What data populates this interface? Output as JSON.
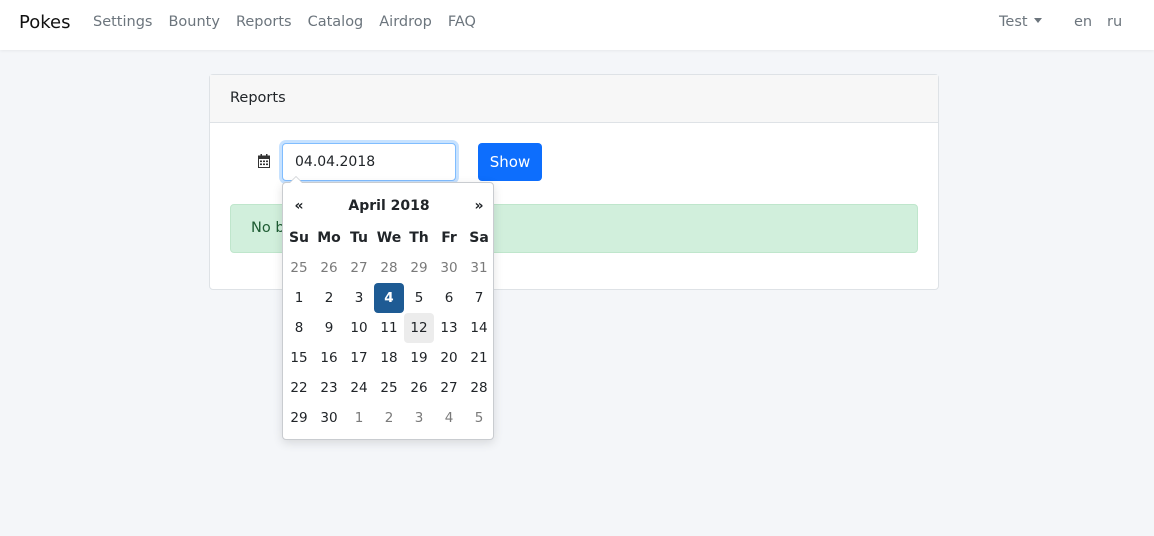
{
  "navbar": {
    "brand": "Pokes",
    "links": [
      "Settings",
      "Bounty",
      "Reports",
      "Catalog",
      "Airdrop",
      "FAQ"
    ],
    "user": "Test",
    "langs": [
      "en",
      "ru"
    ]
  },
  "card": {
    "header": "Reports",
    "date_value": "04.04.2018",
    "show_label": "Show",
    "alert_text": "No b"
  },
  "datepicker": {
    "prev": "«",
    "next": "»",
    "month_title": "April 2018",
    "weekdays": [
      "Su",
      "Mo",
      "Tu",
      "We",
      "Th",
      "Fr",
      "Sa"
    ],
    "weeks": [
      [
        "25",
        "26",
        "27",
        "28",
        "29",
        "30",
        "31"
      ],
      [
        "1",
        "2",
        "3",
        "4",
        "5",
        "6",
        "7"
      ],
      [
        "8",
        "9",
        "10",
        "11",
        "12",
        "13",
        "14"
      ],
      [
        "15",
        "16",
        "17",
        "18",
        "19",
        "20",
        "21"
      ],
      [
        "22",
        "23",
        "24",
        "25",
        "26",
        "27",
        "28"
      ],
      [
        "29",
        "30",
        "1",
        "2",
        "3",
        "4",
        "5"
      ]
    ],
    "selected_day": "4",
    "highlighted_day": "12"
  },
  "colors": {
    "primary": "#0d6efd",
    "selected_day_bg": "#1e5b94",
    "alert_bg": "#d1efdc"
  }
}
